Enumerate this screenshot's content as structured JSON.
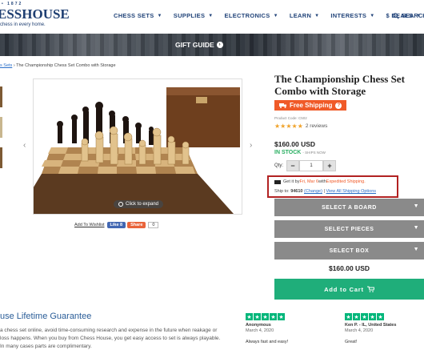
{
  "header": {
    "logo_est": "• 1872",
    "logo_main": "ESSHOUSE",
    "logo_tagline": "chess in every home.",
    "nav": [
      {
        "label": "CHESS SETS"
      },
      {
        "label": "SUPPLIES"
      },
      {
        "label": "ELECTRONICS"
      },
      {
        "label": "LEARN"
      },
      {
        "label": "INTERESTS"
      },
      {
        "label": "$ DEALS"
      }
    ],
    "search_label": "SEARCH",
    "search_icon": "search-icon"
  },
  "banner": {
    "text": "GIFT GUIDE",
    "icon": "circle-arrow-icon"
  },
  "breadcrumb": {
    "link": "s Sets",
    "separator": " › ",
    "current": "The Championship Chess Set Combo with Storage"
  },
  "gallery": {
    "expand_label": "Click to expand",
    "prev_icon": "‹",
    "next_icon": "›"
  },
  "share": {
    "wishlist": "Add To Wishlist",
    "like": "Like 8",
    "share": "Share",
    "count": "0"
  },
  "product": {
    "title": "The Championship Chess Set Combo with Storage",
    "shipping_badge": "Free Shipping",
    "product_code": "Product Code: C502",
    "stars": "★★★★★",
    "reviews": "2 reviews",
    "price": "$160.00 USD",
    "stock": "IN STOCK",
    "ships_now": "- SHIPS NOW",
    "qty_label": "Qty:",
    "qty_value": "1",
    "qty_minus": "−",
    "qty_plus": "+"
  },
  "delivery": {
    "get_it_prefix": "Get it by ",
    "date": "Fri, Mar 6",
    "with": " with ",
    "method": "Expedited Shipping.",
    "ship_to_prefix": "Ship to: ",
    "zip": "94610",
    "change": "(Change)",
    "divider": " | ",
    "view_all": "View All Shipping Options"
  },
  "options": [
    {
      "label": "SELECT A BOARD"
    },
    {
      "label": "SELECT PIECES"
    },
    {
      "label": "SELECT BOX"
    }
  ],
  "total": "$160.00 USD",
  "add_to_cart": "Add to Cart",
  "guarantee": {
    "title": "use Lifetime Guarantee",
    "body": "a chess set online, avoid time-consuming research and expense in the future when reakage or loss happens. When you buy from Chess House, you get easy access to set is always playable. In many cases parts are complimentary."
  },
  "reviews": [
    {
      "stars": "★",
      "name": "Anonymous",
      "date": "March 4, 2020",
      "text": "Always fast and easy!"
    },
    {
      "stars": "★",
      "name": "Ken P. - IL, United States",
      "date": "March 4, 2020",
      "text": "Great!"
    }
  ],
  "colors": {
    "brand_navy": "#1f3f72",
    "accent_orange": "#f05a28",
    "in_stock_green": "#27ae60",
    "cart_green": "#1fae7a",
    "option_gray": "#8a8a8a",
    "highlight_red": "#b22222",
    "trustpilot_green": "#00b67a"
  }
}
